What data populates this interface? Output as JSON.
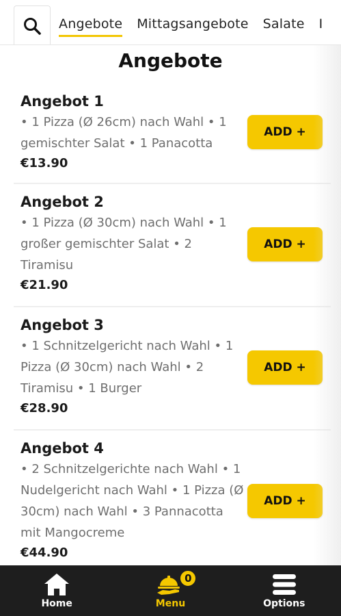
{
  "tabs": [
    {
      "label": "Angebote",
      "active": true
    },
    {
      "label": "Mittagsangebote",
      "active": false
    },
    {
      "label": "Salate",
      "active": false
    },
    {
      "label": "I",
      "active": false
    }
  ],
  "section_title": "Angebote",
  "items": [
    {
      "title": "Angebot 1",
      "desc": "• 1 Pizza (Ø 26cm) nach Wahl • 1 gemischter Salat • 1 Panacotta",
      "price": "€13.90",
      "button": "ADD +"
    },
    {
      "title": "Angebot 2",
      "desc": "• 1 Pizza (Ø 30cm) nach Wahl • 1 großer gemischter Salat • 2 Tiramisu",
      "price": "€21.90",
      "button": "ADD +"
    },
    {
      "title": "Angebot 3",
      "desc": "• 1 Schnitzelgericht nach Wahl • 1 Pizza (Ø 30cm) nach Wahl • 2 Tiramisu • 1 Burger",
      "price": "€28.90",
      "button": "ADD +"
    },
    {
      "title": "Angebot 4",
      "desc": "• 2 Schnitzelgerichte nach Wahl • 1 Nudelgericht nach Wahl • 1 Pizza (Ø 30cm) nach Wahl • 3 Pannacotta mit Mangocreme",
      "price": "€44.90",
      "button": "ADD +"
    }
  ],
  "bottom_nav": {
    "home": {
      "label": "Home",
      "icon": "home-icon"
    },
    "menu": {
      "label": "Menu",
      "icon": "serving-cloche-icon",
      "badge": "0"
    },
    "options": {
      "label": "Options",
      "icon": "hamburger-menu-icon"
    }
  },
  "colors": {
    "accent": "#f5c800",
    "nav_bg": "#1e1e1e"
  }
}
